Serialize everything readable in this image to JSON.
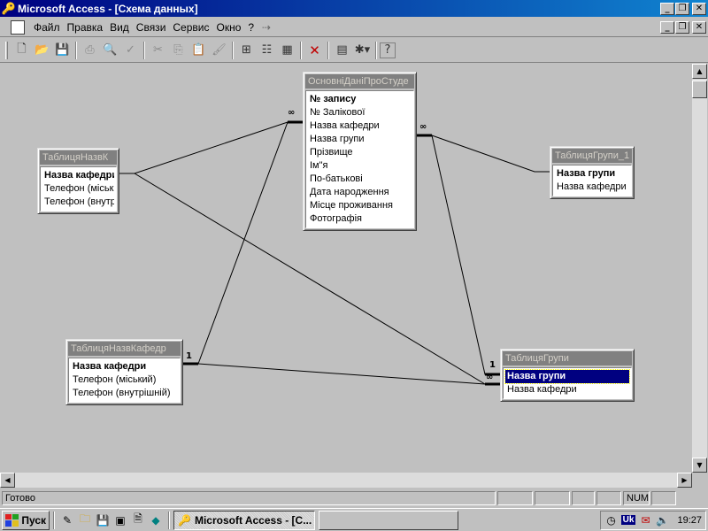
{
  "window": {
    "title": "Microsoft Access - [Схема данных]",
    "minimize_glyph": "_",
    "restore_glyph": "❐",
    "close_glyph": "✕"
  },
  "menu": {
    "items": [
      {
        "label": "Файл"
      },
      {
        "label": "Правка"
      },
      {
        "label": "Вид"
      },
      {
        "label": "Связи"
      },
      {
        "label": "Сервис"
      },
      {
        "label": "Окно"
      },
      {
        "label": "?"
      }
    ]
  },
  "toolbar": {
    "icons": [
      "new-icon",
      "open-icon",
      "save-icon",
      "print-icon",
      "print-preview-icon",
      "spelling-icon",
      "cut-icon",
      "copy-icon",
      "paste-icon",
      "format-painter-icon",
      "show-table-icon",
      "show-direct-icon",
      "show-all-icon",
      "delete-icon",
      "properties-icon",
      "new-object-icon",
      "help-icon"
    ]
  },
  "tables": [
    {
      "id": "main",
      "title": "ОсновніДаніПроСтуде",
      "fields": [
        {
          "label": "№ запису",
          "key": true
        },
        {
          "label": "№ Залікової"
        },
        {
          "label": "Назва кафедри"
        },
        {
          "label": "Назва групи"
        },
        {
          "label": "Прізвище"
        },
        {
          "label": "Ім\"я"
        },
        {
          "label": "По-батькові"
        },
        {
          "label": "Дата народження"
        },
        {
          "label": "Місце проживання"
        },
        {
          "label": "Фотографія"
        }
      ]
    },
    {
      "id": "kaf1",
      "title": "ТаблицяНазвК",
      "fields": [
        {
          "label": "Назва кафедри",
          "key": true
        },
        {
          "label": "Телефон (міськи"
        },
        {
          "label": "Телефон (внутрі"
        }
      ]
    },
    {
      "id": "grp1",
      "title": "ТаблицяГрупи_1",
      "fields": [
        {
          "label": "Назва групи",
          "key": true
        },
        {
          "label": "Назва кафедри"
        }
      ]
    },
    {
      "id": "kaf2",
      "title": "ТаблицяНазвКафедр",
      "fields": [
        {
          "label": "Назва кафедри",
          "key": true
        },
        {
          "label": "Телефон (міський)"
        },
        {
          "label": "Телефон (внутрішній)"
        }
      ]
    },
    {
      "id": "grp2",
      "title": "ТаблицяГрупи",
      "fields": [
        {
          "label": "Назва групи",
          "key": true,
          "selected": true
        },
        {
          "label": "Назва кафедри"
        }
      ]
    }
  ],
  "relationship_marks": {
    "one": "1",
    "many": "∞"
  },
  "statusbar": {
    "status": "Готово",
    "num": "NUM"
  },
  "taskbar": {
    "start_label": "Пуск",
    "active_task": "Microsoft Access - [С...",
    "lang": "Uk",
    "clock": "19:27"
  }
}
